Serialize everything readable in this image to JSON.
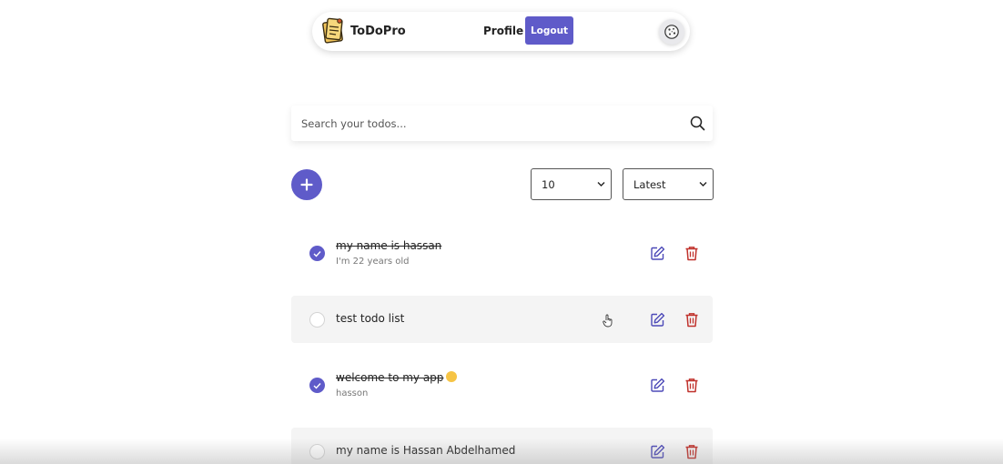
{
  "navbar": {
    "brand": "ToDoPro",
    "profile_label": "Profile",
    "logout_label": "Logout",
    "logo_icon": "sticky-note-icon",
    "theme_icon": "cookie-icon"
  },
  "search": {
    "placeholder": "Search your todos...",
    "value": "",
    "icon": "search-icon"
  },
  "controls": {
    "add_icon": "plus-icon",
    "limit_value": "10",
    "sort_value": "Latest"
  },
  "todos": [
    {
      "title": "my name is hassan",
      "description": "I'm 22 years old",
      "completed": true
    },
    {
      "title": "test todo list",
      "description": "",
      "completed": false
    },
    {
      "title": "welcome to my app",
      "description": "hasson",
      "completed": true,
      "emoji": "grinning-face"
    },
    {
      "title": "my name is Hassan Abdelhamed",
      "description": "",
      "completed": false
    }
  ],
  "colors": {
    "accent": "#5f5bc9",
    "edit": "#4d4ab8",
    "delete": "#c0312b",
    "row_shade": "#f4f4f4"
  }
}
